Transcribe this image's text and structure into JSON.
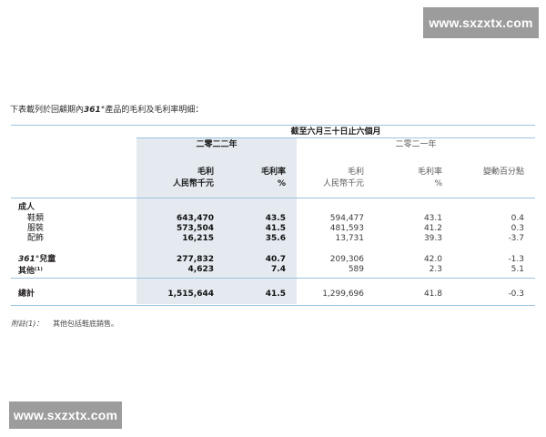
{
  "watermark": {
    "top": "www.sxzxtx.com",
    "bottom": "www.sxzxtx.com"
  },
  "intro": {
    "prefix": "下表載列於回顧期內",
    "brand": "361°",
    "suffix": "產品的毛利及毛利率明細："
  },
  "table": {
    "period_header": "截至六月三十日止六個月",
    "year_current": "二零二二年",
    "year_prior": "二零二一年",
    "col_headers": [
      {
        "line1": "毛利",
        "line2": "人民幣千元"
      },
      {
        "line1": "毛利率",
        "line2": "%"
      },
      {
        "line1": "毛利",
        "line2": "人民幣千元"
      },
      {
        "line1": "毛利率",
        "line2": "%"
      },
      {
        "line1": "變動百分點",
        "line2": ""
      }
    ],
    "section_adult": "成人",
    "rows": [
      {
        "label": "鞋類",
        "cells": [
          "643,470",
          "43.5",
          "594,477",
          "43.1",
          "0.4"
        ]
      },
      {
        "label": "服裝",
        "cells": [
          "573,504",
          "41.5",
          "481,593",
          "41.2",
          "0.3"
        ]
      },
      {
        "label": "配飾",
        "cells": [
          "16,215",
          "35.6",
          "13,731",
          "39.3",
          "-3.7"
        ]
      },
      {
        "label_brand": "361°",
        "label": "兒童",
        "cells": [
          "277,832",
          "40.7",
          "209,306",
          "42.0",
          "-1.3"
        ]
      },
      {
        "label": "其他",
        "label_sup": "(1)",
        "cells": [
          "4,623",
          "7.4",
          "589",
          "2.3",
          "5.1"
        ]
      }
    ],
    "total": {
      "label": "總計",
      "cells": [
        "1,515,644",
        "41.5",
        "1,299,696",
        "41.8",
        "-0.3"
      ]
    }
  },
  "footnote": {
    "mark": "附註(1)：",
    "text": "其他包括鞋底銷售。"
  }
}
